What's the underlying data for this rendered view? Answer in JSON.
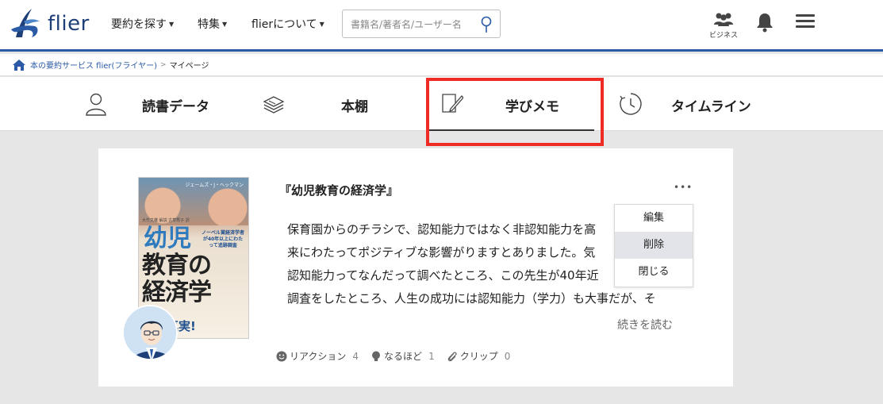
{
  "header": {
    "logo_text": "flier",
    "nav": [
      {
        "label": "要約を探す"
      },
      {
        "label": "特集"
      },
      {
        "label": "flierについて"
      }
    ],
    "search_placeholder": "書籍名/著者名/ユーザー名",
    "business_label": "ビジネス"
  },
  "breadcrumb": {
    "home": "本の要約サービス flier(フライヤー)",
    "current": "マイページ"
  },
  "tabs": [
    {
      "label": "読書データ",
      "icon": "person-icon"
    },
    {
      "label": "本棚",
      "icon": "books-icon"
    },
    {
      "label": "学びメモ",
      "icon": "note-pen-icon",
      "active": true
    },
    {
      "label": "タイムライン",
      "icon": "clock-icon"
    }
  ],
  "memo": {
    "book_title": "『幼児教育の経済学』",
    "cover": {
      "author": "ジェームズ・J・ヘックマン",
      "translator": "大竹文雄 解説 古草秀子 訳",
      "title_lines": [
        "幼児",
        "教育の",
        "経済学"
      ],
      "side_text": "ノーベル賞経済学者が40年以上にわたって追跡調査",
      "bottom_text": "の真実!"
    },
    "body_lines": [
      "保育園からのチラシで、認知能力ではなく非認知能力を高",
      "来にわたってポジティブな影響がりますとありました。気",
      "認知能力ってなんだって調べたところ、この先生が40年近",
      "調査をしたところ、人生の成功には認知能力（学力）も大事だが、そ"
    ],
    "read_more": "続きを読む",
    "stats": [
      {
        "label": "リアクション",
        "count": "4",
        "icon": "smile-icon"
      },
      {
        "label": "なるほど",
        "count": "1",
        "icon": "lightbulb-icon"
      },
      {
        "label": "クリップ",
        "count": "0",
        "icon": "paperclip-icon"
      }
    ],
    "menu": [
      "編集",
      "削除",
      "閉じる"
    ]
  },
  "colors": {
    "brand": "#2a5aa6",
    "highlight": "#ee2b24"
  }
}
